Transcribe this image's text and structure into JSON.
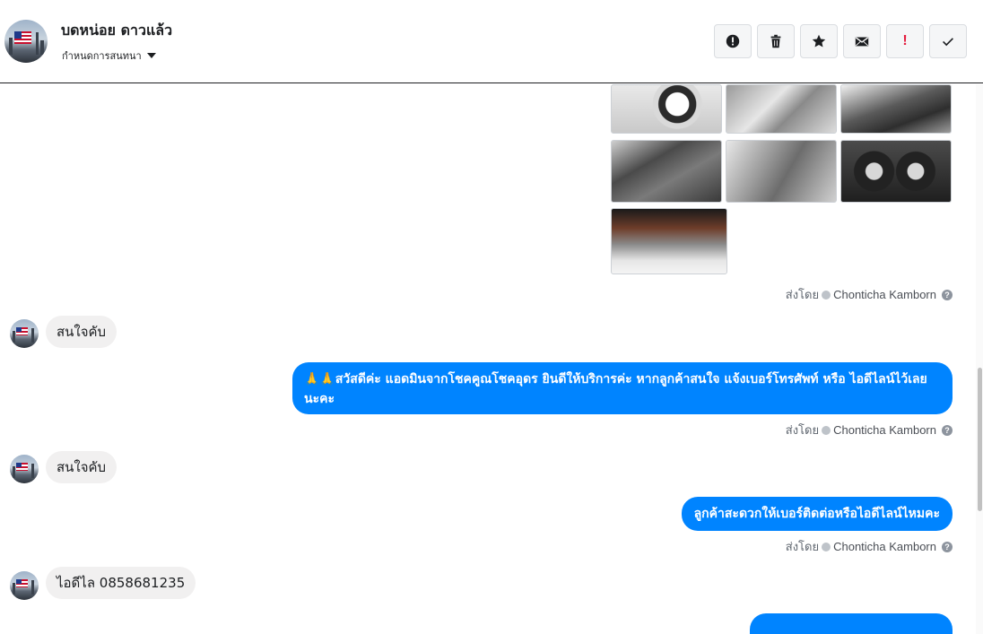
{
  "header": {
    "contact_name": "บดหน่อย ดาวแล้ว",
    "assign_label": "กำหนดการสนทนา",
    "toolbar": [
      {
        "icon": "spam-alert-icon"
      },
      {
        "icon": "trash-icon"
      },
      {
        "icon": "star-icon"
      },
      {
        "icon": "mail-icon"
      },
      {
        "icon": "important-icon",
        "text": "!"
      },
      {
        "icon": "check-icon"
      }
    ]
  },
  "messages": {
    "sent_by_label": "ส่งโดย",
    "agent_name": "Chonticha Kamborn",
    "help_glyph": "?",
    "incoming_1": "สนใจคับ",
    "outgoing_1": "🙏🙏สวัสดีค่ะ แอดมินจากโชคคูณโชคอุดร ยินดีให้บริการค่ะ หากลูกค้าสนใจ แจ้งเบอร์โทรศัพท์ หรือ ไอดีไลน์ไว้เลยนะคะ",
    "incoming_2": "สนใจคับ",
    "outgoing_2": "ลูกค้าสะดวกให้เบอร์ติดต่อหรือไอดีไลน์ไหมคะ",
    "incoming_3": "ไอดีไล 0858681235"
  },
  "colors": {
    "outgoing_bubble": "#0084ff",
    "incoming_bubble": "#f1f0f0",
    "important": "#e41e3f"
  }
}
